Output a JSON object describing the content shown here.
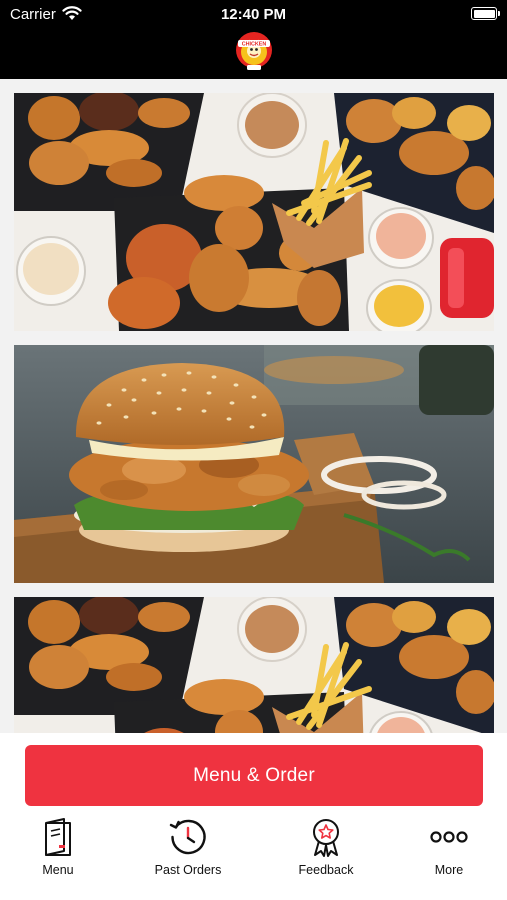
{
  "status_bar": {
    "carrier": "Carrier",
    "time": "12:40 PM"
  },
  "header": {
    "logo_text": "CHICKEN"
  },
  "feed": {
    "items": [
      {
        "image": "fried-chicken-platter-photo"
      },
      {
        "image": "crispy-chicken-burger-photo"
      },
      {
        "image": "fried-chicken-platter-photo"
      }
    ]
  },
  "cta": {
    "label": "Menu & Order",
    "color": "#ef3340"
  },
  "tab_bar": {
    "items": [
      {
        "label": "Menu",
        "icon": "menu-book-icon"
      },
      {
        "label": "Past Orders",
        "icon": "history-clock-icon"
      },
      {
        "label": "Feedback",
        "icon": "award-ribbon-icon"
      },
      {
        "label": "More",
        "icon": "more-dots-icon"
      }
    ]
  }
}
